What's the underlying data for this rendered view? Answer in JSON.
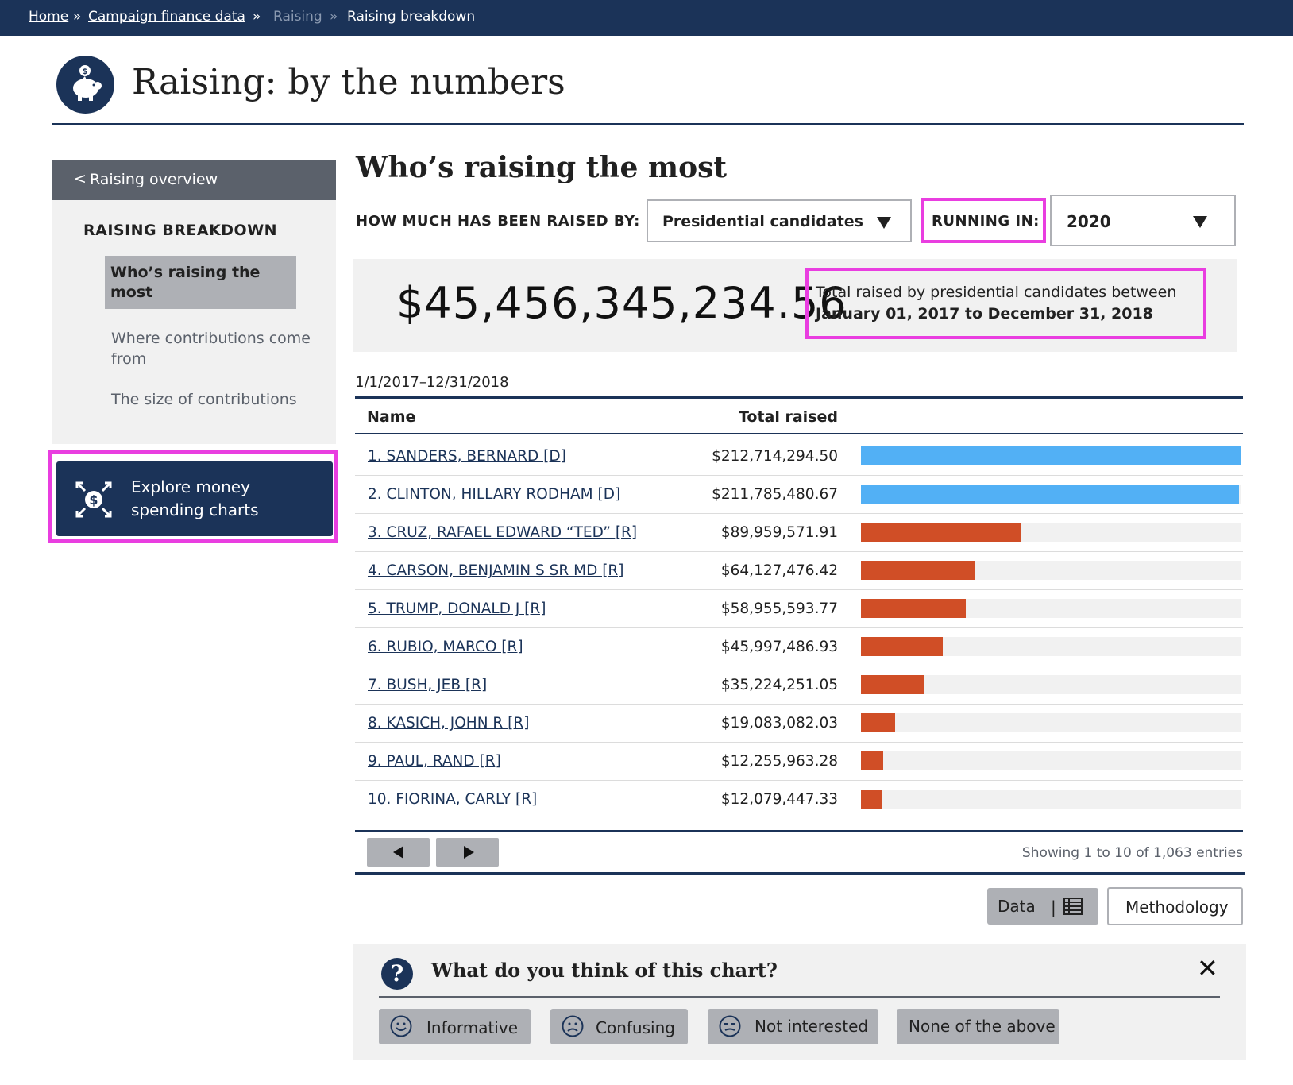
{
  "breadcrumb": {
    "home": "Home",
    "sep": "»",
    "campaign": "Campaign finance data",
    "raising": "Raising",
    "current": "Raising breakdown"
  },
  "header": {
    "title": "Raising: by the numbers"
  },
  "sidebar": {
    "back_chevron": "<",
    "back_label": "Raising overview",
    "heading": "RAISING BREAKDOWN",
    "items": [
      {
        "label": "Who’s raising the most",
        "active": true
      },
      {
        "label": "Where contributions come from",
        "active": false
      },
      {
        "label": "The size of contributions",
        "active": false
      }
    ],
    "explore_label": "Explore money spending charts"
  },
  "main": {
    "title": "Who’s raising the most",
    "raised_by_label": "HOW MUCH HAS BEEN RAISED BY:",
    "raised_by_value": "Presidential candidates",
    "running_in_label": "RUNNING IN:",
    "running_in_value": "2020",
    "total_amount": "$45,456,345,234.56",
    "total_desc_line1": "Total raised by presidential candidates between",
    "total_desc_line2": "January 01, 2017 to December 31, 2018",
    "date_range": "1/1/2017–12/31/2018"
  },
  "table": {
    "columns": [
      "Name",
      "Total raised"
    ],
    "rows": [
      {
        "name": "1. SANDERS, BERNARD [D]",
        "total": "$212,714,294.50",
        "value": 212714294.5,
        "party": "D"
      },
      {
        "name": "2. CLINTON, HILLARY RODHAM [D]",
        "total": "$211,785,480.67",
        "value": 211785480.67,
        "party": "D"
      },
      {
        "name": "3. CRUZ, RAFAEL EDWARD “TED” [R]",
        "total": "$89,959,571.91",
        "value": 89959571.91,
        "party": "R"
      },
      {
        "name": "4. CARSON, BENJAMIN S SR MD [R]",
        "total": "$64,127,476.42",
        "value": 64127476.42,
        "party": "R"
      },
      {
        "name": "5. TRUMP, DONALD J [R]",
        "total": "$58,955,593.77",
        "value": 58955593.77,
        "party": "R"
      },
      {
        "name": "6. RUBIO, MARCO [R]",
        "total": "$45,997,486.93",
        "value": 45997486.93,
        "party": "R"
      },
      {
        "name": "7. BUSH, JEB  [R]",
        "total": "$35,224,251.05",
        "value": 35224251.05,
        "party": "R"
      },
      {
        "name": "8. KASICH, JOHN R [R]",
        "total": "$19,083,082.03",
        "value": 19083082.03,
        "party": "R"
      },
      {
        "name": "9. PAUL, RAND [R]",
        "total": "$12,255,963.28",
        "value": 12255963.28,
        "party": "R"
      },
      {
        "name": "10. FIORINA, CARLY [R]",
        "total": "$12,079,447.33",
        "value": 12079447.33,
        "party": "R"
      }
    ],
    "showing": "Showing  1 to 10 of 1,063 entries"
  },
  "colors": {
    "navy": "#1b3358",
    "dem_bar": "#52b0f5",
    "rep_bar": "#d04e26",
    "highlight": "#e93ee0"
  },
  "icons": {
    "header": "piggy-bank-icon",
    "explore": "money-arrows-icon",
    "data": "table-icon"
  },
  "actions": {
    "data_label": "Data",
    "data_sep": "|",
    "methodology_label": "Methodology"
  },
  "feedback": {
    "question_mark": "?",
    "title": "What do you think of this chart?",
    "close": "✕",
    "options": [
      "Informative",
      "Confusing",
      "Not interested",
      "None of the above"
    ]
  }
}
